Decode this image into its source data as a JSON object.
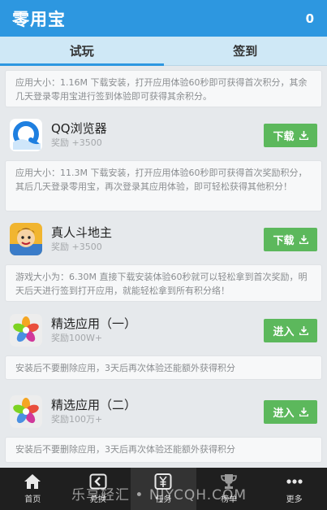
{
  "header": {
    "title": "零用宝",
    "count": "0"
  },
  "tabs": [
    {
      "label": "试玩"
    },
    {
      "label": "签到"
    }
  ],
  "descriptions": [
    "应用大小：1.16M 下载安装，打开应用体验60秒即可获得首次积分，其余几天登录零用宝进行签到体验即可获得其余积分。",
    "应用大小：11.3M 下载安装，打开应用体验60秒即可获得首次奖励积分，其后几天登录零用宝，再次登录其应用体验，即可轻松获得其他积分！",
    "游戏大小为：6.30M 直接下载安装体验60秒就可以轻松拿到首次奖励，明天后天进行签到打开应用，就能轻松拿到所有积分络！",
    "安装后不要删除应用，3天后再次体验还能额外获得积分",
    "安装后不要删除应用，3天后再次体验还能额外获得积分"
  ],
  "items": [
    {
      "name": "QQ浏览器",
      "reward": "奖励 +3500",
      "button": "下载",
      "icon": "qq-browser-icon"
    },
    {
      "name": "真人斗地主",
      "reward": "奖励 +3500",
      "button": "下载",
      "icon": "landlord-game-icon"
    },
    {
      "name": "精选应用（一）",
      "reward": "奖励100W+",
      "button": "进入",
      "icon": "flower-icon"
    },
    {
      "name": "精选应用（二）",
      "reward": "奖励100万+",
      "button": "进入",
      "icon": "flower-icon"
    }
  ],
  "nav": [
    {
      "label": "首页",
      "icon": "home-icon"
    },
    {
      "label": "兑换",
      "icon": "exchange-icon"
    },
    {
      "label": "任务",
      "icon": "task-icon"
    },
    {
      "label": "榜单",
      "icon": "trophy-icon"
    },
    {
      "label": "更多",
      "icon": "more-icon"
    }
  ],
  "watermark": "乐享轻汇 • NJYCQH.COM",
  "colors": {
    "header": "#2d97e0",
    "button": "#5cb85c",
    "nav": "#1f1f1f"
  }
}
